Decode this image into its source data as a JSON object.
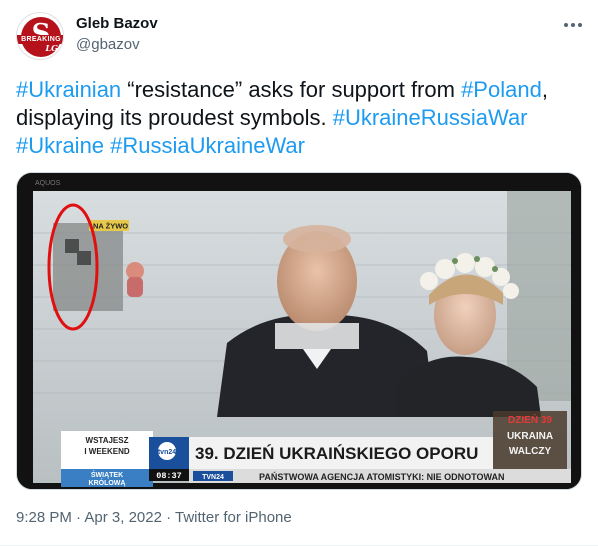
{
  "author": {
    "display_name": "Gleb Bazov",
    "handle": "@gbazov",
    "avatar_letter": "S",
    "avatar_text": "BREAKING",
    "avatar_suffix": "LG"
  },
  "tweet": {
    "segments": [
      {
        "text": "#Ukrainian",
        "tag": true
      },
      {
        "text": " “resistance” asks for support from ",
        "tag": false
      },
      {
        "text": "#Poland",
        "tag": true
      },
      {
        "text": ", displaying its proudest symbols. ",
        "tag": false
      },
      {
        "text": "#UkraineRussiaWar",
        "tag": true
      },
      {
        "text": " ",
        "tag": false
      },
      {
        "text": "#Ukraine",
        "tag": true
      },
      {
        "text": " ",
        "tag": false
      },
      {
        "text": "#RussiaUkraineWar",
        "tag": true
      }
    ]
  },
  "media": {
    "tv_brand": "AQUOS",
    "live_badge": "NA ŻYWO",
    "tvn_logo": "tvn24",
    "side_label_1": "WSTAJESZ",
    "side_label_2": "I WEEKEND",
    "side_label_3": "ŚWIĄTEK",
    "side_label_4": "KRÓLOWĄ",
    "clock": "08:37",
    "headline": "39. DZIEŃ UKRAIŃSKIEGO OPORU",
    "day_badge": "DZIEŃ 39",
    "badge_line_1": "UKRAINA",
    "badge_line_2": "WALCZY",
    "ticker": "PAŃSTWOWA AGENCJA ATOMISTYKI: NIE ODNOTOWAN",
    "ticker_tag": "TVN24"
  },
  "meta": {
    "time": "9:28 PM",
    "sep1": " · ",
    "date": "Apr 3, 2022",
    "sep2": " · ",
    "source": "Twitter for iPhone"
  },
  "colors": {
    "link": "#1d9bf0",
    "secondary": "#536471",
    "annotation": "#e01010",
    "tvn_banner": "#f2f2f2",
    "badge_red": "#c8102e"
  }
}
